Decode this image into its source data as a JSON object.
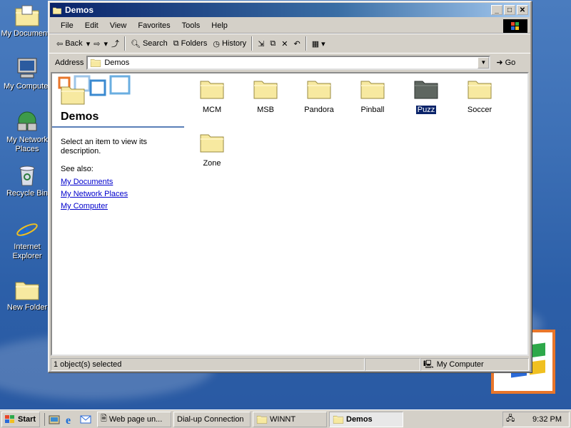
{
  "desktop": {
    "icons": [
      {
        "label": "My Documents"
      },
      {
        "label": "My Computer"
      },
      {
        "label": "My Network Places"
      },
      {
        "label": "Recycle Bin"
      },
      {
        "label": "Internet Explorer"
      },
      {
        "label": "New Folder"
      }
    ]
  },
  "window": {
    "title": "Demos",
    "menu": [
      "File",
      "Edit",
      "View",
      "Favorites",
      "Tools",
      "Help"
    ],
    "toolbar": {
      "back": "Back",
      "search": "Search",
      "folders": "Folders",
      "history": "History"
    },
    "address": {
      "label": "Address",
      "value": "Demos",
      "go": "Go"
    },
    "webview": {
      "title": "Demos",
      "description": "Select an item to view its description.",
      "see_also": "See also:",
      "links": [
        "My Documents",
        "My Network Places",
        "My Computer"
      ]
    },
    "items": [
      {
        "name": "MCM",
        "selected": false
      },
      {
        "name": "MSB",
        "selected": false
      },
      {
        "name": "Pandora",
        "selected": false
      },
      {
        "name": "Pinball",
        "selected": false
      },
      {
        "name": "Puzz",
        "selected": true
      },
      {
        "name": "Soccer",
        "selected": false
      },
      {
        "name": "Zone",
        "selected": false
      }
    ],
    "status": {
      "selection": "1 object(s) selected",
      "zone": "My Computer"
    }
  },
  "taskbar": {
    "start": "Start",
    "tasks": [
      {
        "label": "Web page un...",
        "active": false
      },
      {
        "label": "Dial-up Connection",
        "active": false
      },
      {
        "label": "WINNT",
        "active": false
      },
      {
        "label": "Demos",
        "active": true
      }
    ],
    "clock": "9:32 PM"
  },
  "colors": {
    "titlebar": "#0a246a",
    "selection": "#0a246a",
    "link": "#0000cc",
    "folder": "#f7e9a0",
    "desktop": "#3a6ea5"
  }
}
